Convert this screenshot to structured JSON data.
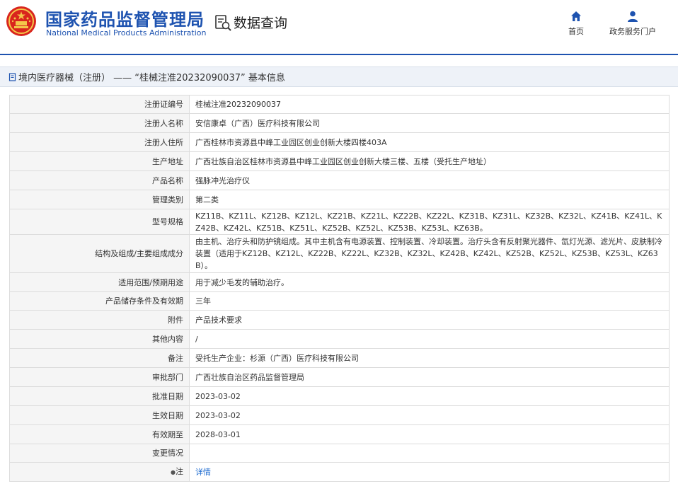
{
  "header": {
    "title_cn": "国家药品监督管理局",
    "title_en": "National Medical Products Administration",
    "search_label": "数据查询",
    "nav": {
      "home": "首页",
      "portal": "政务服务门户"
    }
  },
  "breadcrumb": "境内医疗器械（注册） —— “桂械注准20232090037” 基本信息",
  "rows": [
    {
      "label": "注册证编号",
      "value": "桂械注准20232090037"
    },
    {
      "label": "注册人名称",
      "value": "安信康卓（广西）医疗科技有限公司"
    },
    {
      "label": "注册人住所",
      "value": "广西桂林市资源县中峰工业园区创业创新大楼四楼403A"
    },
    {
      "label": "生产地址",
      "value": "广西壮族自治区桂林市资源县中峰工业园区创业创新大楼三楼、五楼（受托生产地址）"
    },
    {
      "label": "产品名称",
      "value": "强脉冲光治疗仪"
    },
    {
      "label": "管理类别",
      "value": "第二类"
    },
    {
      "label": "型号规格",
      "value": "KZ11B、KZ11L、KZ12B、KZ12L、KZ21B、KZ21L、KZ22B、KZ22L、KZ31B、KZ31L、KZ32B、KZ32L、KZ41B、KZ41L、KZ42B、KZ42L、KZ51B、KZ51L、KZ52B、KZ52L、KZ53B、KZ53L、KZ63B。"
    },
    {
      "label": "结构及组成/主要组成成分",
      "value": "由主机、治疗头和防护镜组成。其中主机含有电源装置、控制装置、冷却装置。治疗头含有反射聚光器件、氙灯光源、滤光片、皮肤制冷装置（适用于KZ12B、KZ12L、KZ22B、KZ22L、KZ32B、KZ32L、KZ42B、KZ42L、KZ52B、KZ52L、KZ53B、KZ53L、KZ63B）。"
    },
    {
      "label": "适用范围/预期用途",
      "value": "用于减少毛发的辅助治疗。"
    },
    {
      "label": "产品储存条件及有效期",
      "value": "三年"
    },
    {
      "label": "附件",
      "value": "产品技术要求"
    },
    {
      "label": "其他内容",
      "value": "/"
    },
    {
      "label": "备注",
      "value": "受托生产企业：杉源（广西）医疗科技有限公司"
    },
    {
      "label": "审批部门",
      "value": "广西壮族自治区药品监督管理局"
    },
    {
      "label": "批准日期",
      "value": "2023-03-02"
    },
    {
      "label": "生效日期",
      "value": "2023-03-02"
    },
    {
      "label": "有效期至",
      "value": "2028-03-01"
    },
    {
      "label": "变更情况",
      "value": ""
    }
  ],
  "note_row": {
    "label": "注",
    "link": "详情"
  },
  "colors": {
    "brand_blue": "#1e53b0",
    "label_bg": "#f5f5f5",
    "link": "#1e6bd0"
  }
}
